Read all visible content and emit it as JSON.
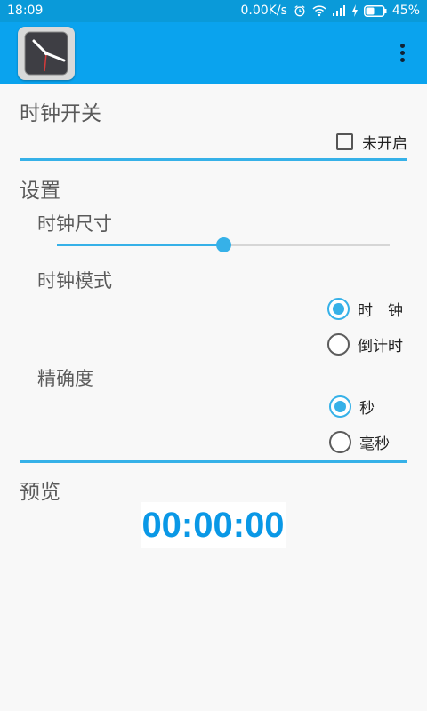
{
  "status_bar": {
    "time": "18:09",
    "network_speed": "0.00K/s",
    "battery": "45%"
  },
  "app_bar": {
    "icon": "clock-app-icon",
    "overflow_icon": "more-vert-icon"
  },
  "clock_switch": {
    "title": "时钟开关",
    "checkbox_label": "未开启",
    "checked": false
  },
  "settings": {
    "title": "设置",
    "size": {
      "label": "时钟尺寸",
      "value_fraction": 0.5
    },
    "mode": {
      "label": "时钟模式",
      "options": [
        "时　钟",
        "倒计时"
      ],
      "selected": 0
    },
    "precision": {
      "label": "精确度",
      "options": [
        "秒",
        "毫秒"
      ],
      "selected": 0
    }
  },
  "preview": {
    "title": "预览",
    "text": "00:00:00"
  },
  "colors": {
    "status_bar": "#0a9ad9",
    "app_bar": "#0aa3ee",
    "accent": "#36b1e8",
    "preview_text": "#0a98e6"
  }
}
